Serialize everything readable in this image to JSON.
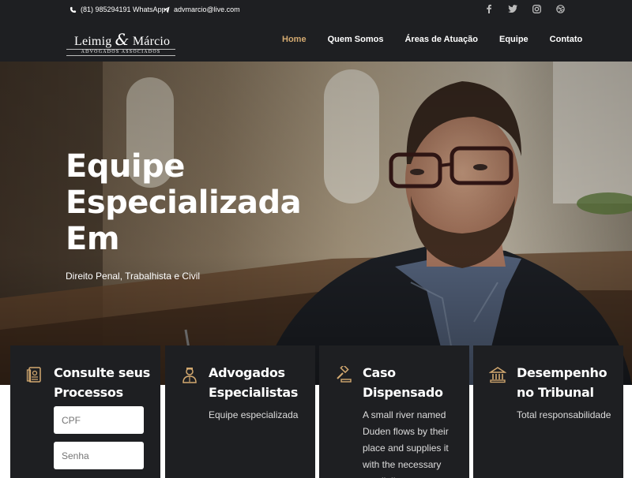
{
  "topbar": {
    "phone": "(81) 985294191 WhatsApp",
    "email": "advmarcio@live.com",
    "social": [
      "facebook-icon",
      "twitter-icon",
      "instagram-icon",
      "dribbble-icon"
    ]
  },
  "logo": {
    "name_left": "Leimig",
    "amp": "&",
    "name_right": "Márcio",
    "tagline": "ADVOGADOS ASSOCIADOS"
  },
  "nav": {
    "items": [
      {
        "label": "Home",
        "active": true
      },
      {
        "label": "Quem Somos"
      },
      {
        "label": "Áreas de Atuação"
      },
      {
        "label": "Equipe"
      },
      {
        "label": "Contato"
      }
    ]
  },
  "hero": {
    "title_line1": "Equipe",
    "title_line2": "Especializada",
    "title_line3": "Em",
    "subtitle": "Direito Penal, Trabalhista e Civil"
  },
  "cards": [
    {
      "title": "Consulte seus Processos",
      "icon": "document-icon",
      "cpf_placeholder": "CPF",
      "senha_placeholder": "Senha"
    },
    {
      "title": "Advogados Especialistas",
      "icon": "lawyer-icon",
      "text": "Equipe especializada"
    },
    {
      "title": "Caso Dispensado",
      "icon": "gavel-icon",
      "text": "A small river named Duden flows by their place and supplies it with the necessary regelialia."
    },
    {
      "title": "Desempenho no Tribunal",
      "icon": "courthouse-icon",
      "text": "Total responsabilidade"
    }
  ],
  "colors": {
    "dark": "#1e1f22",
    "accent": "#d3a970"
  }
}
